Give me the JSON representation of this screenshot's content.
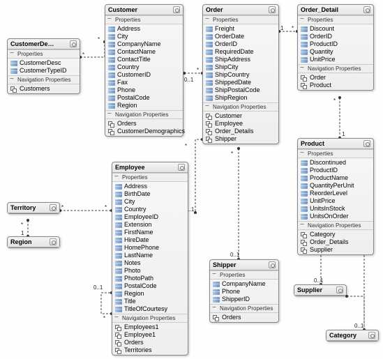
{
  "entities": {
    "customerDemo": {
      "title": "CustomerDe…",
      "sections": {
        "props": {
          "label": "Properties",
          "items": [
            "CustomerDesc",
            "CustomerTypeID"
          ]
        },
        "nav": {
          "label": "Navigation Properties",
          "items": [
            "Customers"
          ]
        }
      }
    },
    "customer": {
      "title": "Customer",
      "sections": {
        "props": {
          "label": "Properties",
          "items": [
            "Address",
            "City",
            "CompanyName",
            "ContactName",
            "ContactTitle",
            "Country",
            "CustomerID",
            "Fax",
            "Phone",
            "PostalCode",
            "Region"
          ]
        },
        "nav": {
          "label": "Navigation Properties",
          "items": [
            "Orders",
            "CustomerDemographics"
          ]
        }
      }
    },
    "order": {
      "title": "Order",
      "sections": {
        "props": {
          "label": "Properties",
          "items": [
            "Freight",
            "OrderDate",
            "OrderID",
            "RequiredDate",
            "ShipAddress",
            "ShipCity",
            "ShipCountry",
            "ShippedDate",
            "ShipPostalCode",
            "ShipRegion"
          ]
        },
        "nav": {
          "label": "Navigation Properties",
          "items": [
            "Customer",
            "Employee",
            "Order_Details",
            "Shipper"
          ]
        }
      }
    },
    "orderDetail": {
      "title": "Order_Detail",
      "sections": {
        "props": {
          "label": "Properties",
          "items": [
            "Discount",
            "OrderID",
            "ProductID",
            "Quantity",
            "UnitPrice"
          ]
        },
        "nav": {
          "label": "Navigation Properties",
          "items": [
            "Order",
            "Product"
          ]
        }
      }
    },
    "product": {
      "title": "Product",
      "sections": {
        "props": {
          "label": "Properties",
          "items": [
            "Discontinued",
            "ProductID",
            "ProductName",
            "QuantityPerUnit",
            "ReorderLevel",
            "UnitPrice",
            "UnitsInStock",
            "UnitsOnOrder"
          ]
        },
        "nav": {
          "label": "Navigation Properties",
          "items": [
            "Category",
            "Order_Details",
            "Supplier"
          ]
        }
      }
    },
    "employee": {
      "title": "Employee",
      "sections": {
        "props": {
          "label": "Properties",
          "items": [
            "Address",
            "BirthDate",
            "City",
            "Country",
            "EmployeeID",
            "Extension",
            "FirstName",
            "HireDate",
            "HomePhone",
            "LastName",
            "Notes",
            "Photo",
            "PhotoPath",
            "PostalCode",
            "Region",
            "Title",
            "TitleOfCourtesy"
          ]
        },
        "nav": {
          "label": "Navigation Properties",
          "items": [
            "Employees1",
            "Employee1",
            "Orders",
            "Territories"
          ]
        }
      }
    },
    "shipper": {
      "title": "Shipper",
      "sections": {
        "props": {
          "label": "Properties",
          "items": [
            "CompanyName",
            "Phone",
            "ShipperID"
          ]
        },
        "nav": {
          "label": "Navigation Properties",
          "items": [
            "Orders"
          ]
        }
      }
    },
    "supplier": {
      "title": "Supplier"
    },
    "category": {
      "title": "Category"
    },
    "territory": {
      "title": "Territory"
    },
    "region": {
      "title": "Region"
    }
  },
  "cardinality": {
    "star": "*",
    "one": "1",
    "zeroOne": "0..1"
  }
}
